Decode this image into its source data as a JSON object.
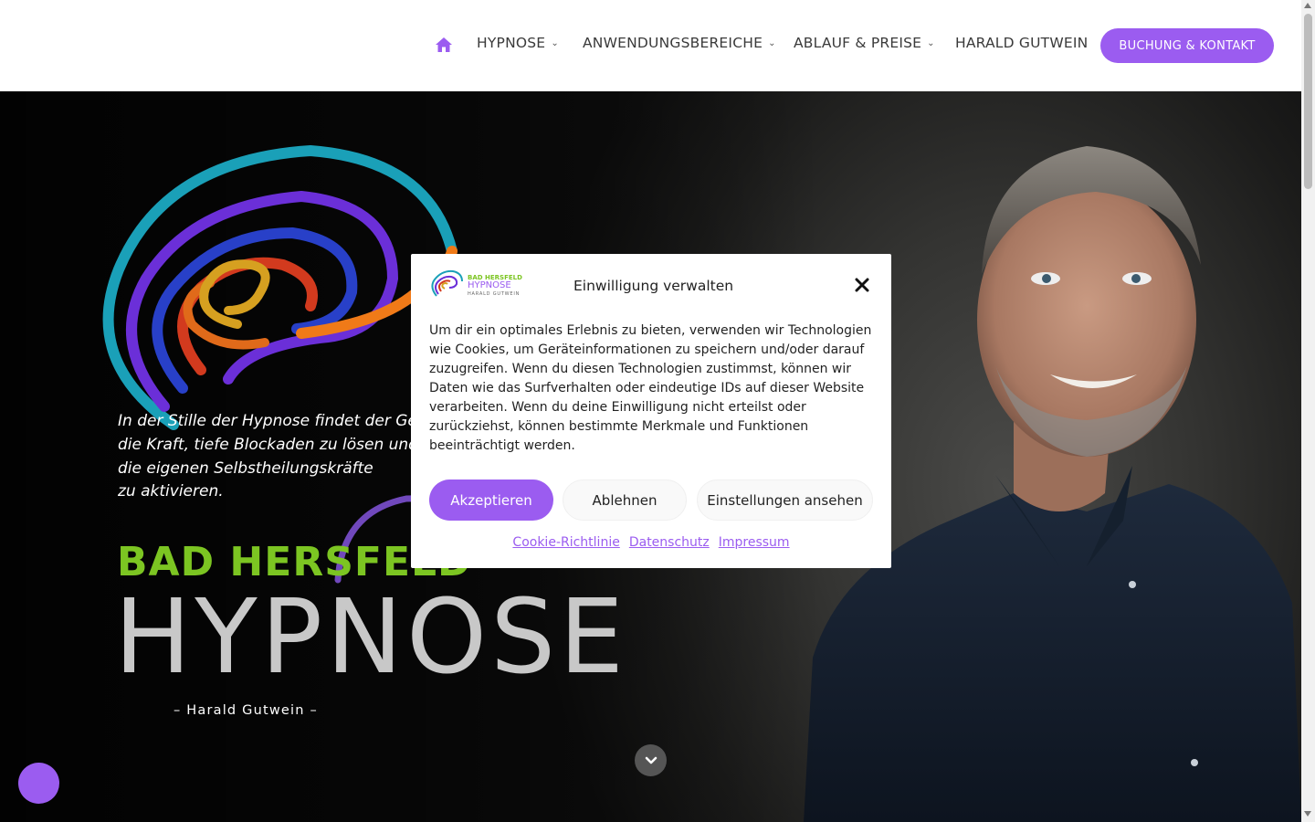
{
  "nav": {
    "home_icon": "home-icon",
    "items": [
      {
        "label": "HYPNOSE",
        "has_dropdown": true
      },
      {
        "label": "ANWENDUNGSBEREICHE",
        "has_dropdown": true
      },
      {
        "label": "ABLAUF & PREISE",
        "has_dropdown": true
      },
      {
        "label": "HARALD GUTWEIN",
        "has_dropdown": false
      }
    ],
    "cta_label": "BUCHUNG & KONTAKT",
    "chevron": "⌄"
  },
  "hero": {
    "quote": "In der Stille der Hypnose findet der Geist die Kraft, tiefe Blockaden zu lösen und die eigenen Selbstheilungskräfte zu aktivieren.",
    "quote_lines": [
      "In der Stille der Hypnose findet der Ge",
      "die Kraft, tiefe Blockaden zu lösen und",
      "die eigenen Selbstheilungskräfte",
      "zu aktivieren."
    ],
    "brand_sub": "BAD HERSFELD",
    "brand_main": "HYPNOSE",
    "brand_author": "– Harald Gutwein –"
  },
  "consent": {
    "logo_lines": [
      "BAD HERSFELD",
      "HYPNOSE",
      "HARALD GUTWEIN"
    ],
    "title": "Einwilligung verwalten",
    "text": "Um dir ein optimales Erlebnis zu bieten, verwenden wir Technologien wie Cookies, um Geräteinformationen zu speichern und/oder darauf zuzugreifen. Wenn du diesen Technologien zustimmst, können wir Daten wie das Surfverhalten oder eindeutige IDs auf dieser Website verarbeiten. Wenn du deine Einwilligung nicht erteilst oder zurückziehst, können bestimmte Merkmale und Funktionen beeinträchtigt werden.",
    "accept": "Akzeptieren",
    "deny": "Ablehnen",
    "preferences": "Einstellungen ansehen",
    "links": [
      "Cookie-Richtlinie",
      "Datenschutz",
      "Impressum"
    ]
  },
  "colors": {
    "accent": "#9b5cf0",
    "brand_green": "#7cc522",
    "brand_grey": "#c8c8c8"
  }
}
